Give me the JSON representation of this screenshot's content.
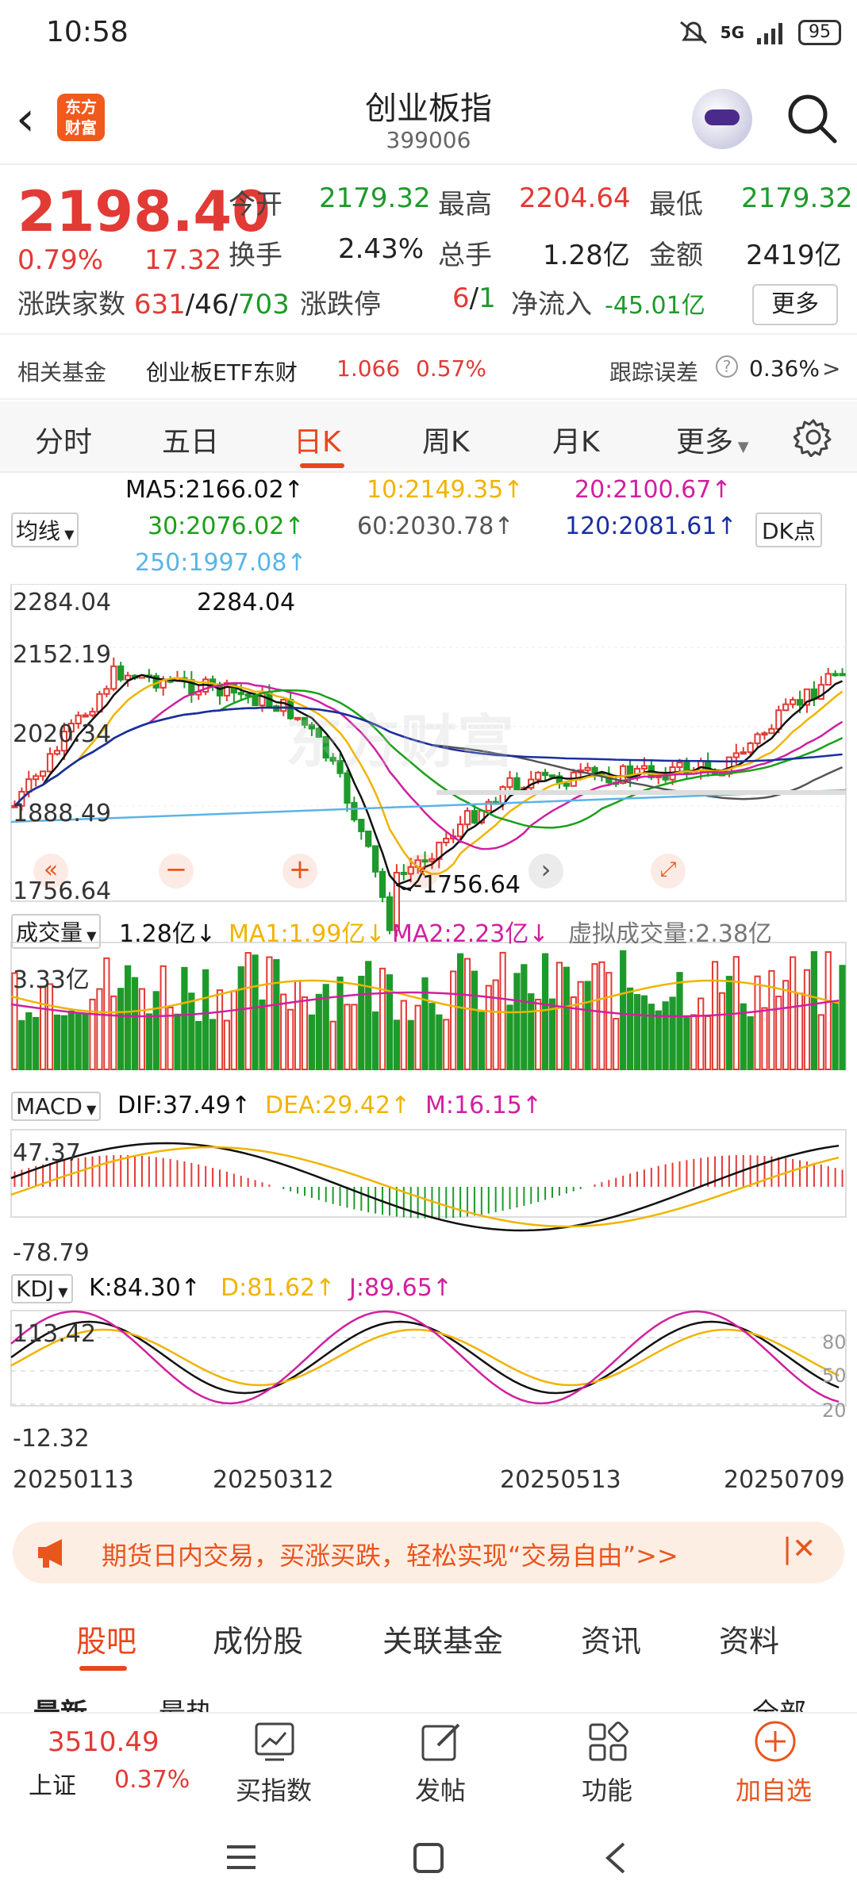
{
  "status": {
    "time": "10:58",
    "network": "5G",
    "battery": "95"
  },
  "header": {
    "title": "创业板指",
    "code": "399006",
    "logo": "东方\n财富"
  },
  "quote": {
    "price": "2198.40",
    "pct": "0.79%",
    "change": "17.32",
    "open_label": "今开",
    "open": "2179.32",
    "high_label": "最高",
    "high": "2204.64",
    "low_label": "最低",
    "low": "2179.32",
    "turnover_label": "换手",
    "turnover": "2.43%",
    "volume_label": "总手",
    "volume": "1.28亿",
    "amount_label": "金额",
    "amount": "2419亿",
    "breadth_label": "涨跌家数",
    "up": "631",
    "flat": "46",
    "down": "703",
    "limit_label": "涨跌停",
    "limit_up": "6",
    "limit_down": "1",
    "inflow_label": "净流入",
    "inflow": "-45.01亿",
    "more": "更多"
  },
  "fund": {
    "label": "相关基金",
    "name": "创业板ETF东财",
    "price": "1.066",
    "pct": "0.57%",
    "track_label": "跟踪误差",
    "track": "0.36%"
  },
  "tabs": [
    "分时",
    "五日",
    "日K",
    "周K",
    "月K",
    "更多"
  ],
  "ma": {
    "selector": "均线",
    "dk": "DK点",
    "ma5": "MA5:2166.02↑",
    "ma10": "10:2149.35↑",
    "ma20": "20:2100.67↑",
    "ma30": "30:2076.02↑",
    "ma60": "60:2030.78↑",
    "ma120": "120:2081.61↑",
    "ma250": "250:1997.08↑",
    "c5": "#111111",
    "c10": "#f0b400",
    "c20": "#d020a0",
    "c30": "#1aa01a",
    "c60": "#555555",
    "c120": "#1a2fa0",
    "c250": "#5ab4e6"
  },
  "kline": {
    "axis": [
      "2284.04",
      "2152.19",
      "2020.34",
      "1888.49",
      "1756.64"
    ],
    "max_label": "2284.04",
    "min_label": "<-1756.64",
    "watermark": "东方财富"
  },
  "vol": {
    "selector": "成交量",
    "val": "1.28亿↓",
    "ma1": "MA1:1.99亿↓",
    "ma2": "MA2:2.23亿↓",
    "virtual": "虚拟成交量:2.38亿",
    "axis": "3.33亿"
  },
  "macd": {
    "selector": "MACD",
    "dif": "DIF:37.49↑",
    "dea": "DEA:29.42↑",
    "m": "M:16.15↑",
    "top": "47.37",
    "bottom": "-78.79"
  },
  "kdj": {
    "selector": "KDJ",
    "k": "K:84.30↑",
    "d": "D:81.62↑",
    "j": "J:89.65↑",
    "top": "113.42",
    "bottom": "-12.32",
    "l80": "80",
    "l50": "50",
    "l20": "20"
  },
  "dates": [
    "20250113",
    "20250312",
    "20250513",
    "20250709"
  ],
  "banner": {
    "text": "期货日内交易，买涨买跌，轻松实现“交易自由”>>"
  },
  "bottom_tabs": [
    "股吧",
    "成份股",
    "关联基金",
    "资讯",
    "资料"
  ],
  "partial": {
    "left": "最新",
    "left2": "最热",
    "right": "全部"
  },
  "nav": {
    "index_price": "3510.49",
    "index_name": "上证",
    "index_pct": "0.37%",
    "buy": "买指数",
    "post": "发帖",
    "func": "功能",
    "add": "加自选"
  }
}
